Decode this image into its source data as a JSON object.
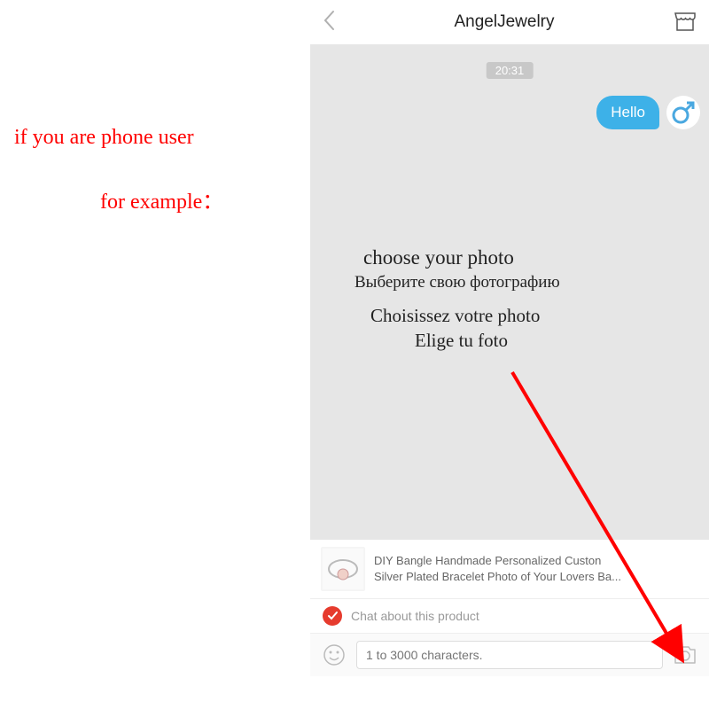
{
  "annotations": {
    "line1": "if you are phone user",
    "line2": "for example："
  },
  "header": {
    "title": "AngelJewelry"
  },
  "chat": {
    "timestamp": "20:31",
    "message": "Hello"
  },
  "overlay": {
    "en": "choose your photo",
    "ru": "Выберите свою фотографию",
    "fr": "Choisissez votre photo",
    "es": "Elige tu foto"
  },
  "product": {
    "line1": "DIY Bangle Handmade Personalized Custon",
    "line2": "Silver Plated Bracelet Photo of Your Lovers Ba..."
  },
  "chat_about": "Chat about this product",
  "input": {
    "placeholder": "1 to 3000 characters."
  }
}
